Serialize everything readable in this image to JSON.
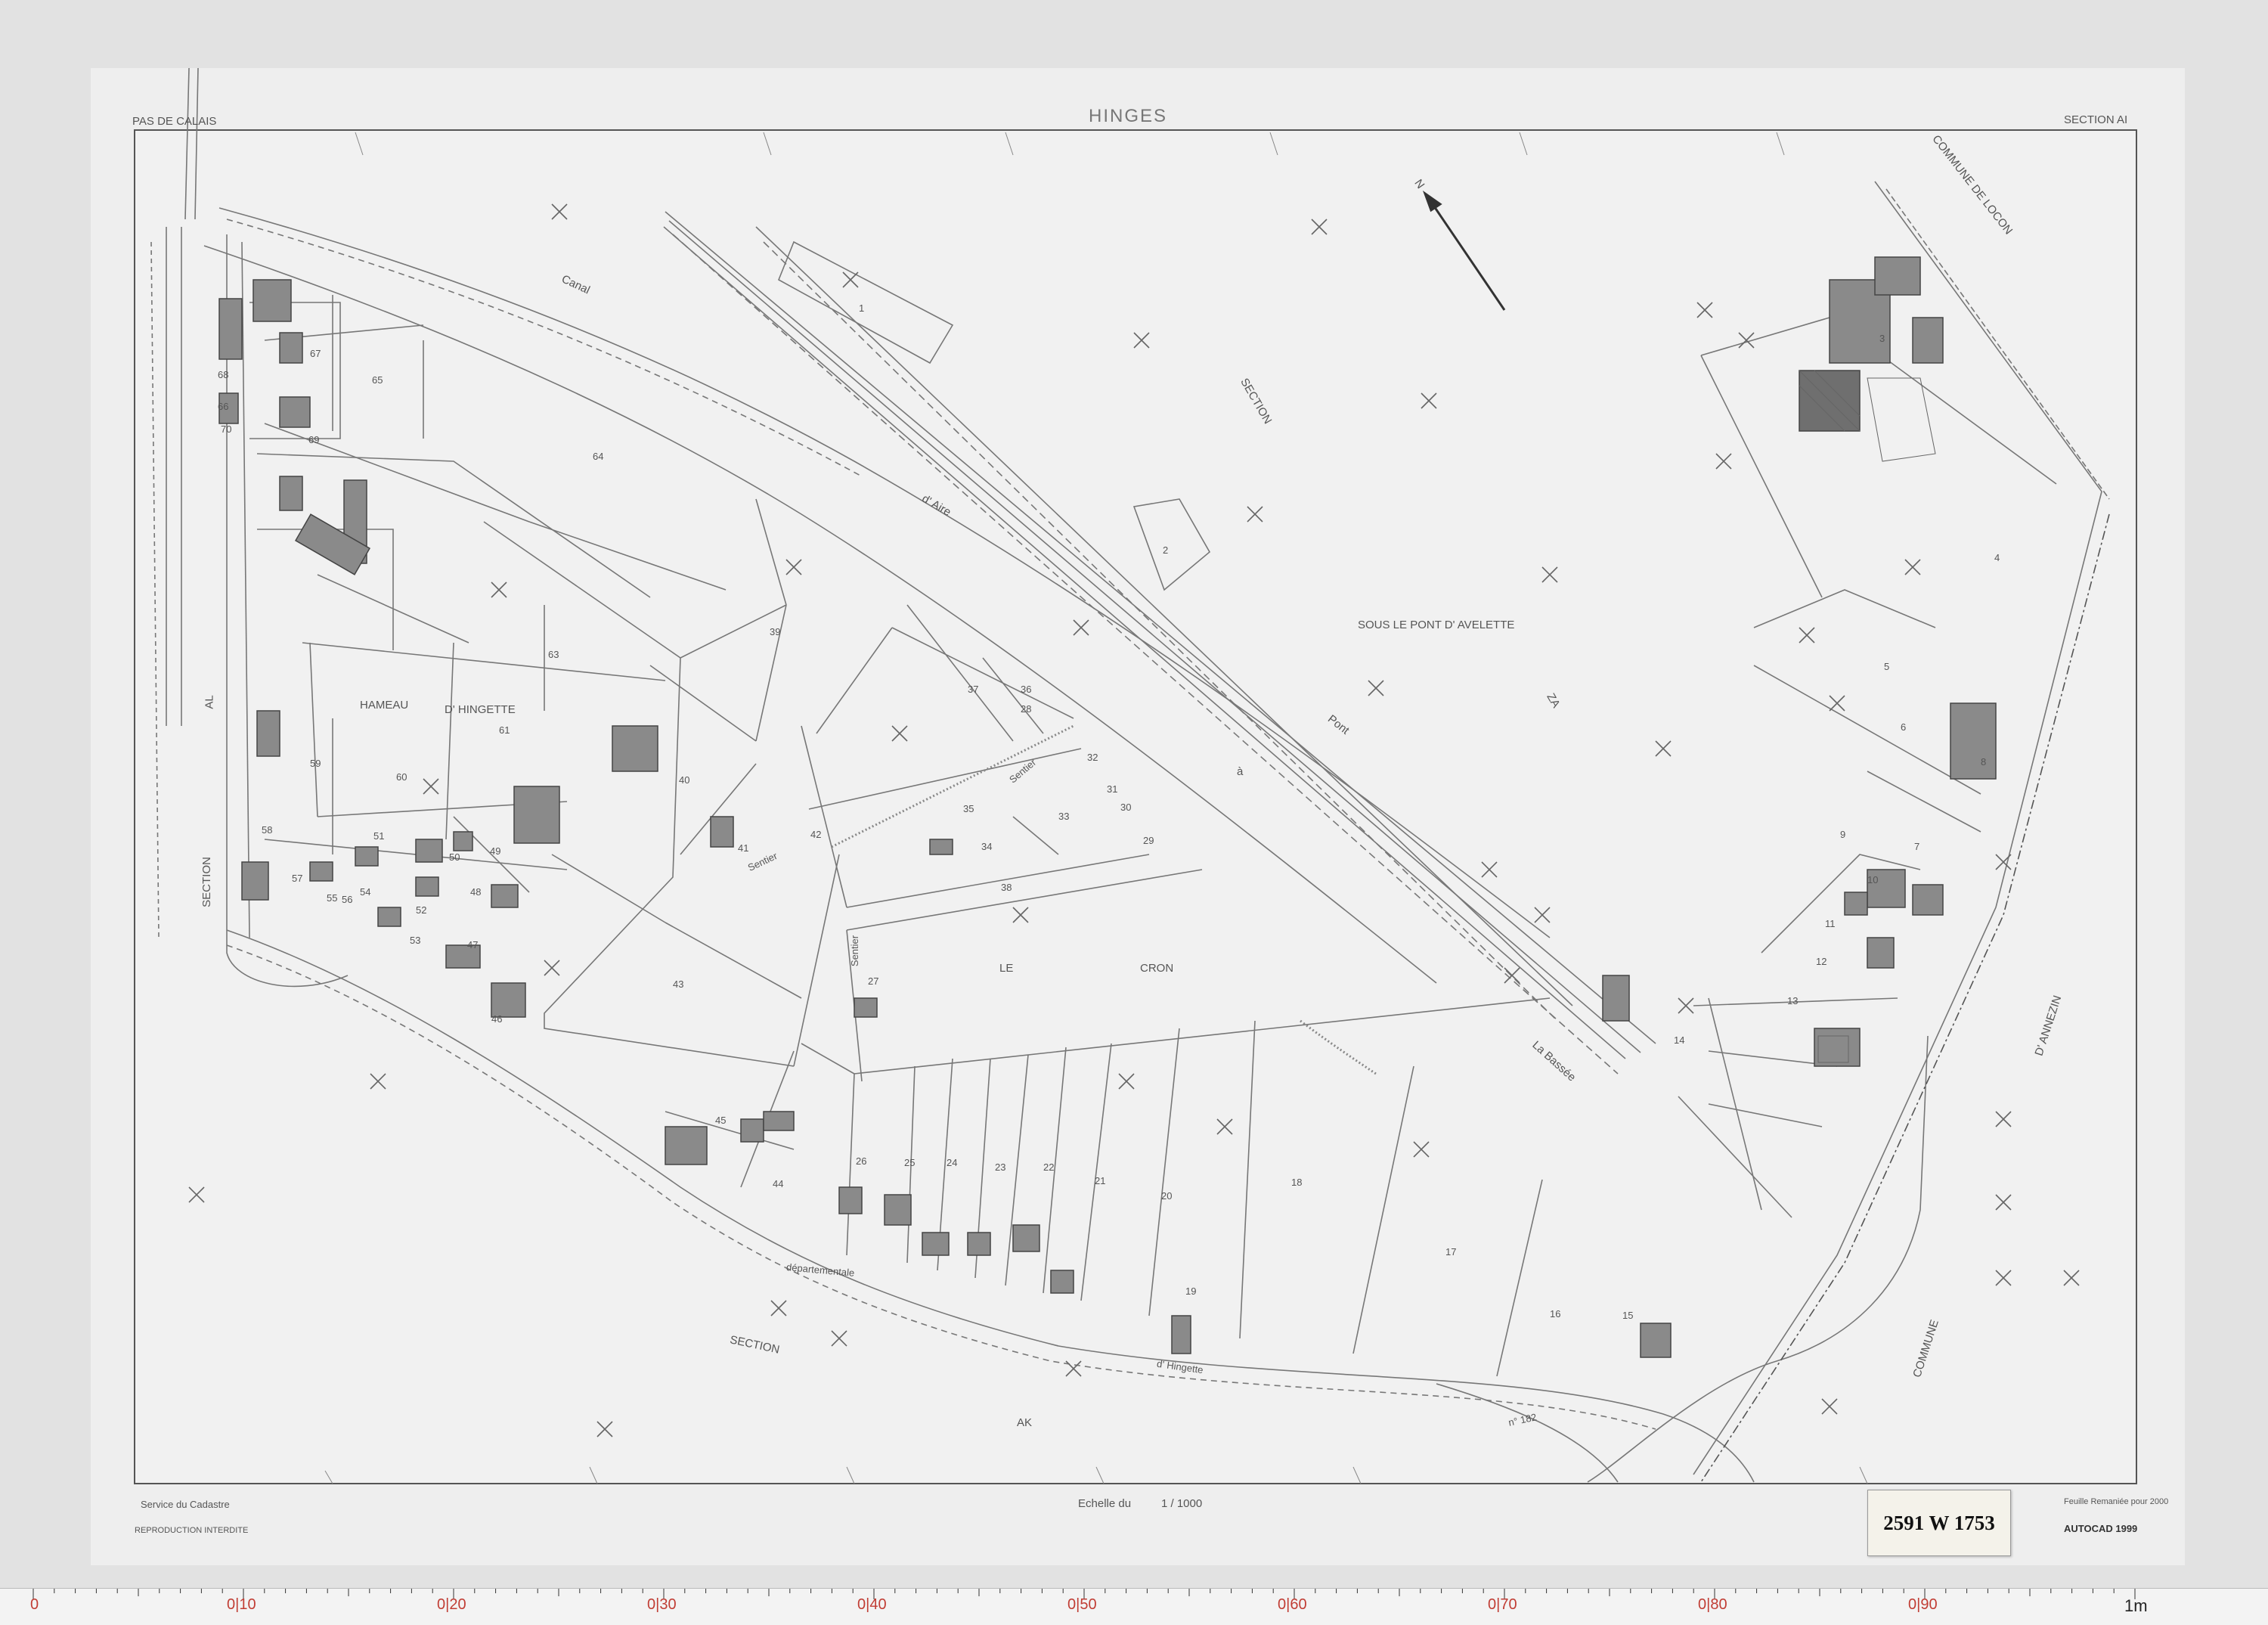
{
  "header": {
    "department": "PAS DE CALAIS",
    "commune": "HINGES",
    "section": "SECTION AI"
  },
  "footer": {
    "service": "Service du Cadastre",
    "reproduction": "REPRODUCTION  INTERDITE",
    "scale_prefix": "Echelle du",
    "scale_value": "1 / 1000",
    "remaniement": "Feuille Remaniée pour 2000",
    "software": "AUTOCAD 1999",
    "archive_ref": "2591 W 1753"
  },
  "map_labels": {
    "canal": "Canal",
    "d_aire": "d' Aire",
    "a_la": "à",
    "la_bassee": "La Bassée",
    "section_za_1": "SECTION",
    "section_za_2": "ZA",
    "lieu_dit_1": "SOUS   LE   PONT   D' AVELETTE",
    "hameau": "HAMEAU",
    "hingette": "D' HINGETTE",
    "le": "LE",
    "cron": "CRON",
    "section_ak_1": "SECTION",
    "section_ak_2": "AK",
    "section_al_1": "AL",
    "section_al_2": "SECTION",
    "commune_locon": "COMMUNE   DE   LOCON",
    "commune_annezin_1": "COMMUNE",
    "commune_annezin_2": "D' ANNEZIN",
    "north": "N",
    "chemin_departemental": "départementale",
    "route_hingette": "d' Hingette",
    "rd_number": "n° 182",
    "pont": "Pont",
    "sentier_1": "Sentier",
    "sentier_2": "Sentier",
    "sentier_3": "Sentier"
  },
  "parcels": [
    "67",
    "68",
    "65",
    "66",
    "69",
    "70",
    "64",
    "63",
    "61",
    "60",
    "59",
    "58",
    "57",
    "56",
    "55",
    "54",
    "53",
    "52",
    "51",
    "50",
    "49",
    "48",
    "47",
    "46",
    "45",
    "44",
    "43",
    "42",
    "41",
    "40",
    "39",
    "38",
    "37",
    "36",
    "35",
    "34",
    "33",
    "32",
    "31",
    "30",
    "29",
    "28",
    "27",
    "26",
    "25",
    "24",
    "23",
    "22",
    "21",
    "20",
    "19",
    "18",
    "17",
    "16",
    "15",
    "14",
    "13",
    "12",
    "11",
    "10",
    "9",
    "8",
    "7",
    "6",
    "5",
    "4",
    "3",
    "2",
    "1"
  ],
  "ruler": {
    "unit_label": "1m",
    "decimeter_labels": [
      "0",
      "0|10",
      "0|20",
      "0|30",
      "0|40",
      "0|50",
      "0|60",
      "0|70",
      "0|80",
      "0|90"
    ]
  }
}
